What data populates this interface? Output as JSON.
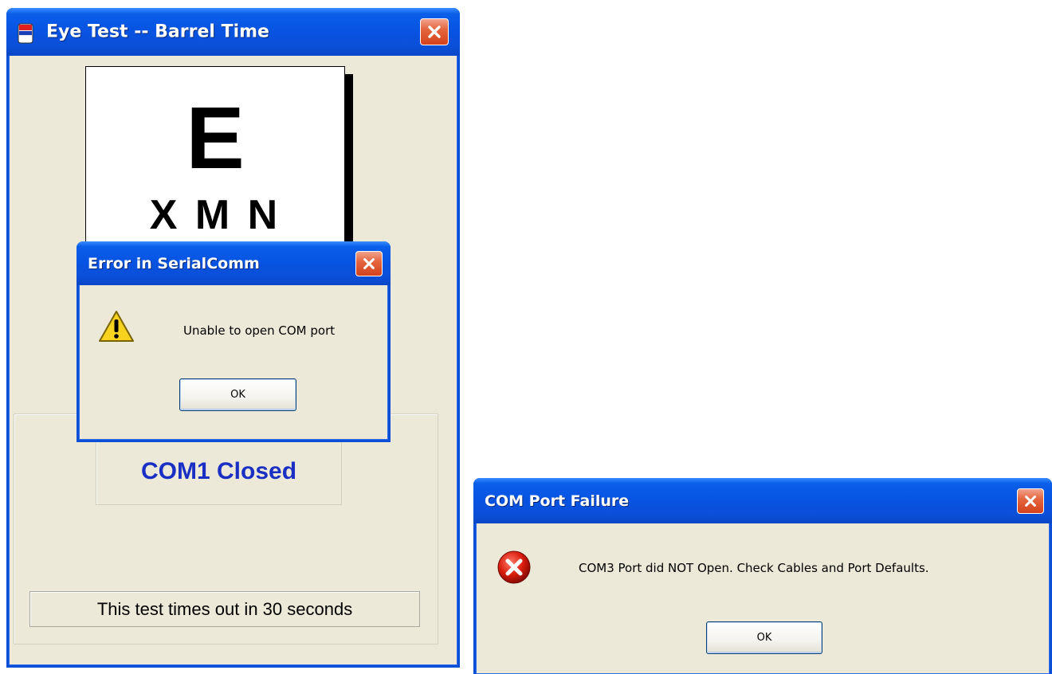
{
  "main_window": {
    "title": "Eye Test -- Barrel Time",
    "eye_chart": {
      "large_letter": "E",
      "row_letters": "X M N"
    },
    "status": "COM1 Closed",
    "timeout_message": "This test times out in 30 seconds"
  },
  "serial_dialog": {
    "title": "Error in SerialComm",
    "icon": "warning-icon",
    "message": "Unable to open COM port",
    "ok_label": "OK"
  },
  "com_dialog": {
    "title": "COM Port Failure",
    "icon": "error-icon",
    "message": "COM3 Port did NOT Open.  Check Cables and Port Defaults.",
    "ok_label": "OK"
  },
  "colors": {
    "titlebar": "#0a54e3",
    "window_bg": "#ece9d8",
    "status_text": "#1a2fc4",
    "close_button": "#d4421c"
  }
}
